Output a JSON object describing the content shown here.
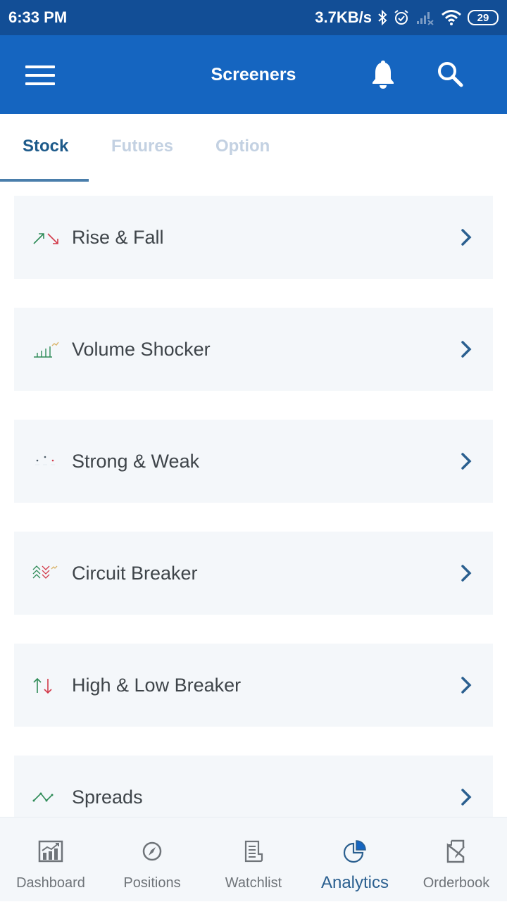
{
  "status_bar": {
    "time": "6:33 PM",
    "network_speed": "3.7KB/s",
    "icons": [
      "bluetooth-icon",
      "alarm-icon",
      "signal-icon",
      "wifi-icon"
    ],
    "battery": "29"
  },
  "app_bar": {
    "title": "Screeners",
    "icons": [
      "menu-icon",
      "bell-icon",
      "search-icon"
    ],
    "color": "#1565c0"
  },
  "tabs": [
    {
      "label": "Stock",
      "active": true
    },
    {
      "label": "Futures",
      "active": false
    },
    {
      "label": "Option",
      "active": false
    }
  ],
  "screeners": [
    {
      "label": "Rise & Fall",
      "icon": "rise-fall-arrows-icon"
    },
    {
      "label": "Volume Shocker",
      "icon": "volume-bars-icon"
    },
    {
      "label": "Strong & Weak",
      "icon": "strong-weak-icon"
    },
    {
      "label": "Circuit Breaker",
      "icon": "circuit-breaker-chevrons-icon"
    },
    {
      "label": "High & Low Breaker",
      "icon": "up-down-arrows-icon"
    },
    {
      "label": "Spreads",
      "icon": "spreads-line-icon"
    }
  ],
  "bottom_nav": [
    {
      "label": "Dashboard",
      "icon": "dashboard-chart-icon",
      "active": false
    },
    {
      "label": "Positions",
      "icon": "compass-icon",
      "active": false
    },
    {
      "label": "Watchlist",
      "icon": "document-list-icon",
      "active": false
    },
    {
      "label": "Analytics",
      "icon": "pie-chart-icon",
      "active": true
    },
    {
      "label": "Orderbook",
      "icon": "edit-document-icon",
      "active": false
    }
  ],
  "colors": {
    "status_bar": "#124e96",
    "app_bar": "#1565c0",
    "tab_active": "#1d5a8a",
    "tab_inactive": "#c3d1e2",
    "card_bg": "#f4f7fa",
    "rise_green": "#2e8b57",
    "fall_red": "#d23a4a",
    "chevron": "#2a5f8f",
    "nav_active": "#2a5f8f",
    "nav_inactive": "#6f7479"
  }
}
